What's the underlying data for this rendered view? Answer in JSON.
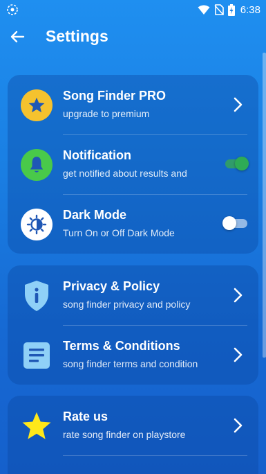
{
  "status_bar": {
    "time": "6:38",
    "left_icon": "sync-icon",
    "icons": [
      "wifi-icon",
      "no-sim-icon",
      "battery-charging-icon"
    ]
  },
  "app_bar": {
    "title": "Settings",
    "back_icon": "arrow-left-icon"
  },
  "colors": {
    "background": "#1a7fe3",
    "card": "#0a46a0",
    "pro_icon_bg": "#f5c22e",
    "notification_icon_bg": "#49c94a",
    "toggle_on": "#2eab55",
    "star": "#ffe81a"
  },
  "groups": [
    {
      "items": [
        {
          "title": "Song Finder PRO",
          "subtitle": "upgrade to premium",
          "icon": "star-badge-icon",
          "control": "chevron"
        },
        {
          "title": "Notification",
          "subtitle": "get notified about results and",
          "icon": "bell-icon",
          "control": "toggle",
          "toggle_on": true
        },
        {
          "title": "Dark Mode",
          "subtitle": "Turn On or Off Dark Mode",
          "icon": "brightness-icon",
          "control": "toggle",
          "toggle_on": false
        }
      ]
    },
    {
      "items": [
        {
          "title": "Privacy & Policy",
          "subtitle": "song finder privacy and policy",
          "icon": "shield-info-icon",
          "control": "chevron"
        },
        {
          "title": "Terms & Conditions",
          "subtitle": "song finder terms and condition",
          "icon": "document-icon",
          "control": "chevron"
        }
      ]
    },
    {
      "items": [
        {
          "title": "Rate us",
          "subtitle": "rate song finder on playstore",
          "icon": "star-icon",
          "control": "chevron"
        }
      ]
    }
  ]
}
